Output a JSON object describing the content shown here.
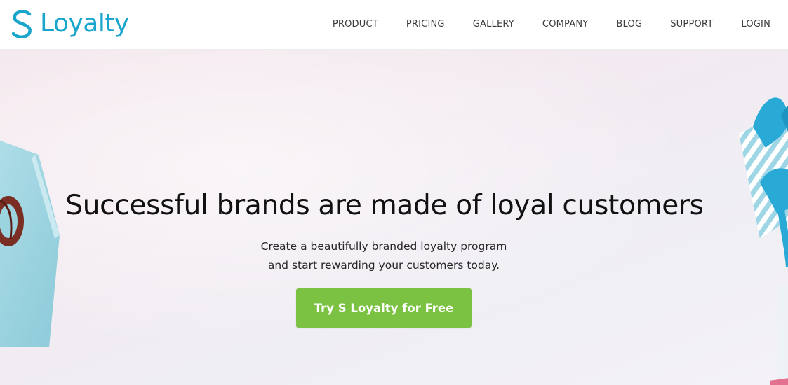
{
  "brand": {
    "name": "Loyalty",
    "mark_glyph": "S",
    "color": "#1aa6cc"
  },
  "nav": {
    "items": [
      {
        "label": "PRODUCT"
      },
      {
        "label": "PRICING"
      },
      {
        "label": "GALLERY"
      },
      {
        "label": "COMPANY"
      },
      {
        "label": "BLOG"
      },
      {
        "label": "SUPPORT"
      },
      {
        "label": "LOGIN"
      }
    ]
  },
  "hero": {
    "title": "Successful brands are made of loyal customers",
    "subtitle_line1": "Create a beautifully branded loyalty program",
    "subtitle_line2": "and start rewarding your customers today.",
    "cta_label": "Try S Loyalty for Free",
    "cta_color": "#7cc242",
    "background_images": [
      "gift-box-left",
      "gift-box-right"
    ]
  }
}
